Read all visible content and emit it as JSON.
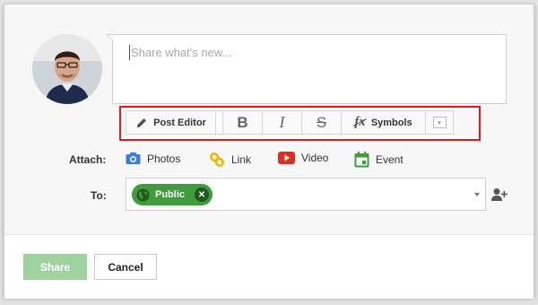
{
  "composer": {
    "placeholder": "Share what's new..."
  },
  "toolbar": {
    "post_editor_label": "Post Editor",
    "post_editor_icon": "pencil-icon",
    "bold_label": "B",
    "italic_label": "I",
    "strike_label": "S",
    "symbols_icon": "fx-icon",
    "symbols_fx": "fx",
    "symbols_label": "Symbols",
    "more_icon": "dropdown-arrow-icon",
    "highlight_color": "#e01a1a"
  },
  "attach": {
    "label": "Attach:",
    "items": [
      {
        "label": "Photos",
        "icon": "camera-icon",
        "color": "#3b7de0"
      },
      {
        "label": "Link",
        "icon": "link-icon",
        "color": "#f0b400"
      },
      {
        "label": "Video",
        "icon": "video-icon",
        "color": "#d93025"
      },
      {
        "label": "Event",
        "icon": "calendar-icon",
        "color": "#3f9d3b"
      }
    ]
  },
  "to": {
    "label": "To:",
    "chip_label": "Public",
    "chip_icon": "globe-icon",
    "chip_color": "#3f9d3b",
    "add_icon": "add-person-icon"
  },
  "footer": {
    "share_label": "Share",
    "cancel_label": "Cancel",
    "share_color": "#9fd29e"
  }
}
